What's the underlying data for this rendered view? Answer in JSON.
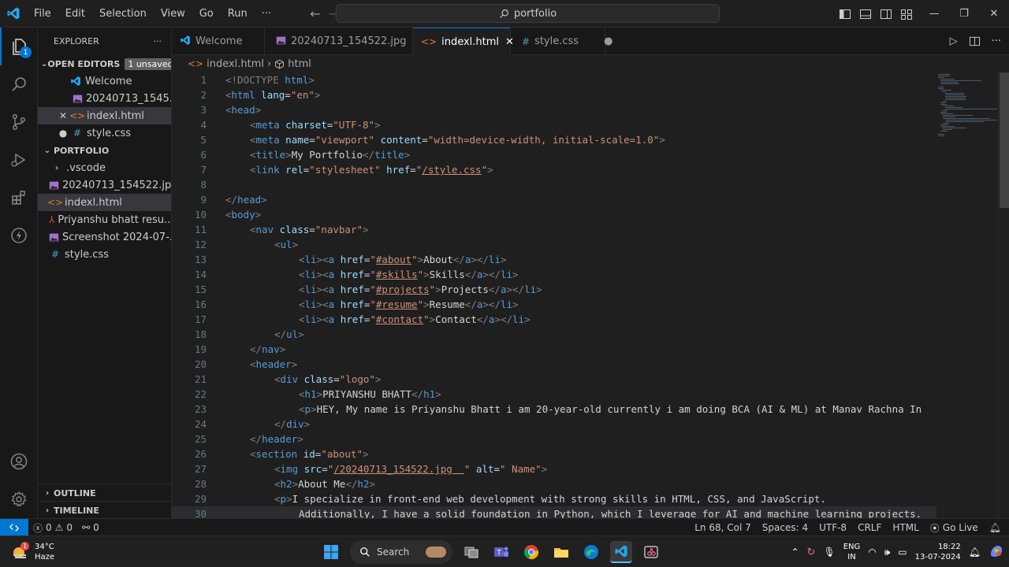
{
  "titlebar": {
    "menu": [
      "File",
      "Edit",
      "Selection",
      "View",
      "Go",
      "Run",
      "···"
    ],
    "search_text": "portfolio"
  },
  "activitybar": {
    "explorer_badge": "1"
  },
  "sidebar": {
    "title": "EXPLORER",
    "more": "···",
    "open_editors": {
      "header": "OPEN EDITORS",
      "badge": "1 unsaved",
      "items": [
        {
          "label": "Welcome",
          "icon": "vscode-icon"
        },
        {
          "label": "20240713_1545...",
          "icon": "image-icon"
        },
        {
          "label": "indexl.html",
          "icon": "html-icon",
          "lead": "✕"
        },
        {
          "label": "style.css",
          "icon": "css-icon",
          "lead": "●"
        }
      ]
    },
    "portfolio": {
      "header": "PORTFOLIO",
      "items": [
        {
          "label": ".vscode",
          "icon": "chevron-right-icon"
        },
        {
          "label": "20240713_154522.jpg",
          "icon": "image-icon"
        },
        {
          "label": "indexl.html",
          "icon": "html-icon"
        },
        {
          "label": "Priyanshu bhatt resu...",
          "icon": "pdf-icon"
        },
        {
          "label": "Screenshot 2024-07-...",
          "icon": "image-icon"
        },
        {
          "label": "style.css",
          "icon": "css-icon"
        }
      ]
    },
    "outline": "OUTLINE",
    "timeline": "TIMELINE"
  },
  "tabs": [
    {
      "label": "Welcome"
    },
    {
      "label": "20240713_154522.jpg"
    },
    {
      "label": "indexl.html"
    },
    {
      "label": "style.css"
    }
  ],
  "breadcrumb": {
    "file": "indexl.html",
    "separator": "›",
    "node": "html"
  },
  "editor": {
    "line_numbers": [
      "1",
      "2",
      "3",
      "4",
      "5",
      "6",
      "7",
      "8",
      "9",
      "10",
      "11",
      "12",
      "13",
      "14",
      "15",
      "16",
      "17",
      "18",
      "19",
      "20",
      "21",
      "22",
      "23",
      "24",
      "25",
      "26",
      "27",
      "28",
      "29",
      "30"
    ],
    "t": {
      "l1_doctype": "<!DOCTYPE",
      "l1_html": " html",
      "l1_end": ">",
      "html": "html",
      "head": "head",
      "meta": "meta",
      "title": "title",
      "link": "link",
      "body": "body",
      "nav": "nav",
      "ul": "ul",
      "li": "li",
      "a": "a",
      "header": "header",
      "div": "div",
      "h1": "h1",
      "p": "p",
      "section": "section",
      "img": "img",
      "h2": "h2",
      "lang": " lang",
      "charset": " charset",
      "name": " name",
      "content": " content",
      "rel": " rel",
      "href": " href",
      "class": " class",
      "id": " id",
      "src": " src",
      "alt": " alt",
      "en": "\"en\"",
      "utf8": "\"UTF-8\"",
      "viewport": "\"viewport\"",
      "viewport_content": "\"width=device-width, initial-scale=1.0\"",
      "stylesheet": "\"stylesheet\"",
      "style_href": "/style.css",
      "navbar": "\"navbar\"",
      "logo": "\"logo\"",
      "about_id": "\"about\"",
      "hash_about": "#about",
      "hash_skills": "#skills",
      "hash_projects": "#projects",
      "hash_resume": "#resume",
      "hash_contact": "#contact",
      "img_src": "/20240713_154522.jpg  ",
      "alt_val": "\" Name\"",
      "title_text": "My Portfolio",
      "about_text": "About",
      "skills_text": "Skills",
      "projects_text": "Projects",
      "resume_text": "Resume",
      "contact_text": "Contact",
      "h1_text": "PRIYANSHU BHATT",
      "p23_text": "HEY, My name is Priyanshu Bhatt i am 20-year-old currently i am doing BCA (AI & ML) at Manav Rachna In",
      "h2_text": "About Me",
      "p29_text": "I specialize in front-end web development with strong skills in HTML, CSS, and JavaScript.",
      "l30_text": "Additionally, I have a solid foundation in Python, which I leverage for AI and machine learning projects."
    }
  },
  "statusbar": {
    "errors": "0",
    "warnings": "0",
    "ports": "0",
    "position": "Ln 68, Col 7",
    "spaces": "Spaces: 4",
    "encoding": "UTF-8",
    "eol": "CRLF",
    "language": "HTML",
    "golive": "Go Live"
  },
  "taskbar": {
    "weather_temp": "34°C",
    "weather_desc": "Haze",
    "weather_badge": "1",
    "search": "Search",
    "lang_1": "ENG",
    "lang_2": "IN",
    "time": "18:22",
    "date": "13-07-2024"
  }
}
